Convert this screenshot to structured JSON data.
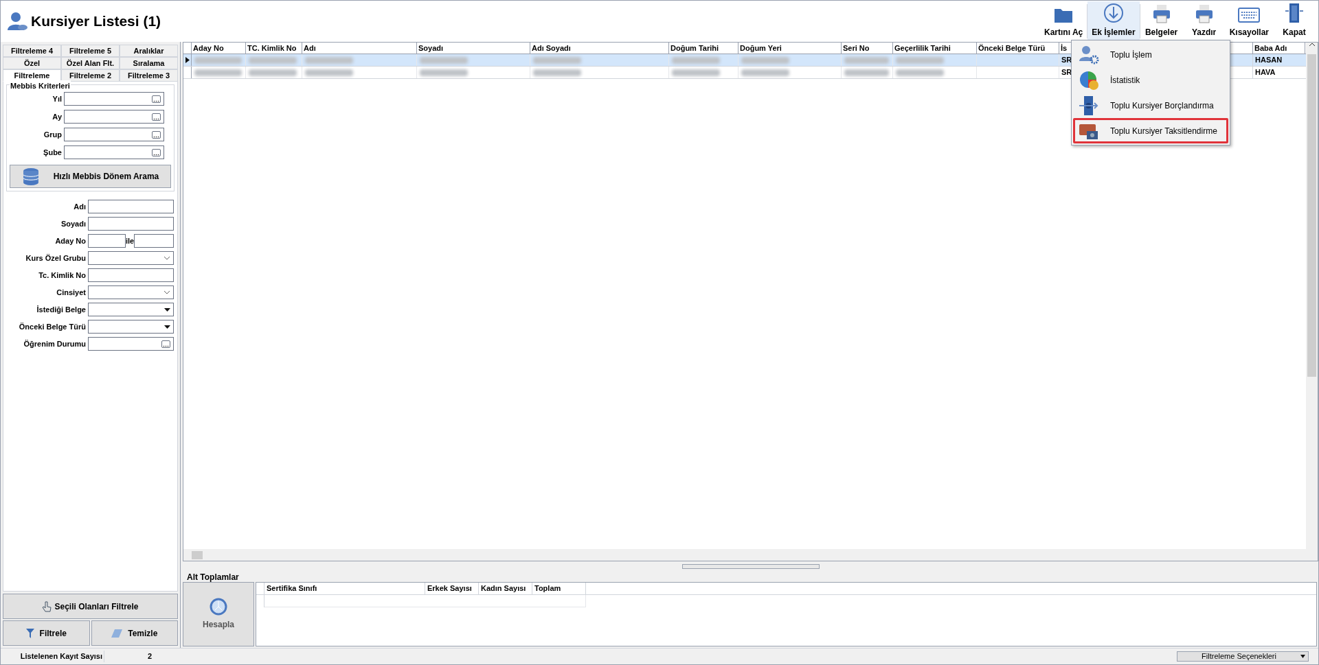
{
  "window": {
    "title": "Kursiyer Listesi (1)"
  },
  "toolbar": [
    {
      "label": "Kartını Aç",
      "selected": false
    },
    {
      "label": "Ek İşlemler",
      "selected": true
    },
    {
      "label": "Belgeler",
      "selected": false
    },
    {
      "label": "Yazdır",
      "selected": false
    },
    {
      "label": "Kısayollar",
      "selected": false
    },
    {
      "label": "Kapat",
      "selected": false
    }
  ],
  "context_menu": {
    "items": [
      {
        "label": "Toplu İşlem",
        "selected": false
      },
      {
        "label": "İstatistik",
        "selected": false
      },
      {
        "label": "Toplu Kursiyer Borçlandırma",
        "selected": false
      },
      {
        "label": "Toplu Kursiyer Taksitlendirme",
        "selected": true
      }
    ]
  },
  "filter_panel": {
    "tab_rows": [
      [
        {
          "label": "Filtreleme 4",
          "selected": false
        },
        {
          "label": "Filtreleme 5",
          "selected": false
        },
        {
          "label": "Aralıklar",
          "selected": false
        }
      ],
      [
        {
          "label": "Özel",
          "selected": false
        },
        {
          "label": "Özel Alan Flt.",
          "selected": false
        },
        {
          "label": "Sıralama",
          "selected": false
        }
      ],
      [
        {
          "label": "Filtreleme",
          "selected": true
        },
        {
          "label": "Filtreleme 2",
          "selected": false
        },
        {
          "label": "Filtreleme 3",
          "selected": false
        }
      ]
    ],
    "group": {
      "title": "Mebbis Kriterleri",
      "fields": [
        {
          "label": "Yıl"
        },
        {
          "label": "Ay"
        },
        {
          "label": "Grup"
        },
        {
          "label": "Şube"
        }
      ],
      "button": "Hızlı Mebbis Dönem Arama"
    },
    "fields": [
      {
        "label": "Adı",
        "kind": "text"
      },
      {
        "label": "Soyadı",
        "kind": "text"
      },
      {
        "label": "Aday No",
        "kind": "range",
        "joiner": "ile"
      },
      {
        "label": "Kurs Özel Grubu",
        "kind": "combo"
      },
      {
        "label": "Tc. Kimlik No",
        "kind": "text"
      },
      {
        "label": "Cinsiyet",
        "kind": "combo"
      },
      {
        "label": "İstediği Belge",
        "kind": "dropdown"
      },
      {
        "label": "Önceki Belge Türü",
        "kind": "dropdown"
      },
      {
        "label": "Öğrenim Durumu",
        "kind": "picker"
      }
    ],
    "select_button": "Seçili Olanları Filtrele",
    "filter_button": "Filtrele",
    "clear_button": "Temizle"
  },
  "grid": {
    "columns": [
      "Aday No",
      "TC. Kimlik No",
      "Adı",
      "Soyadı",
      "Adı Soyadı",
      "Doğum Tarihi",
      "Doğum Yeri",
      "Seri No",
      "Geçerlilik Tarihi",
      "Önceki Belge Türü",
      "İs",
      "Baba Adı"
    ],
    "rows": [
      {
        "selected": true,
        "column_11": "SR",
        "baba_adi": "HASAN"
      },
      {
        "selected": false,
        "column_11": "SR",
        "baba_adi": "HAVA"
      }
    ]
  },
  "subtotals": {
    "title": "Alt Toplamlar",
    "button": "Hesapla",
    "columns": [
      "Sertifika Sınıfı",
      "Erkek Sayısı",
      "Kadın Sayısı",
      "Toplam"
    ]
  },
  "status_bar": {
    "label": "Listelenen Kayıt Sayısı",
    "value": "2",
    "options": "Filtreleme Seçenekleri"
  }
}
